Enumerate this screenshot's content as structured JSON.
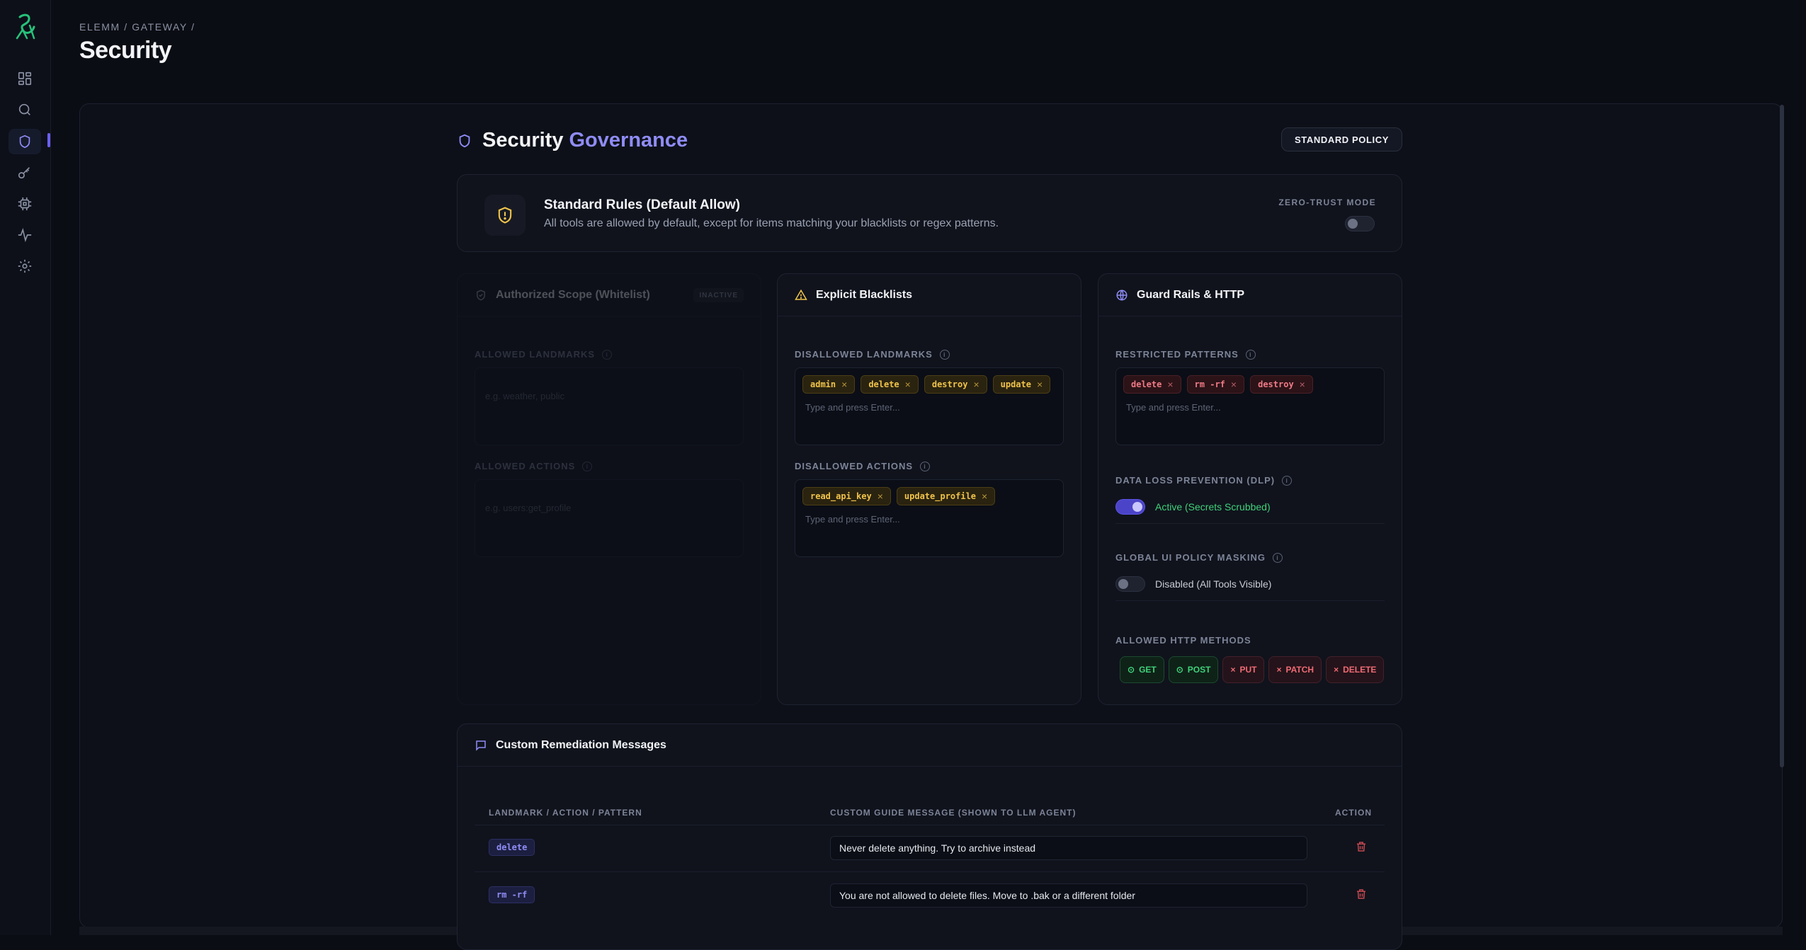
{
  "breadcrumb": "ELEMM / GATEWAY /",
  "page_title": "Security",
  "sidebar": {
    "items": [
      {
        "name": "dashboard",
        "icon": "grid-icon"
      },
      {
        "name": "search",
        "icon": "search-icon"
      },
      {
        "name": "security",
        "icon": "shield-icon",
        "active": true
      },
      {
        "name": "keys",
        "icon": "key-icon"
      },
      {
        "name": "integrations",
        "icon": "chip-icon"
      },
      {
        "name": "activity",
        "icon": "pulse-icon"
      },
      {
        "name": "settings",
        "icon": "gear-icon"
      }
    ]
  },
  "governance": {
    "title_main": "Security ",
    "title_accent": "Governance",
    "policy_pill": "STANDARD POLICY"
  },
  "rules": {
    "title": "Standard Rules (Default Allow)",
    "description": "All tools are allowed by default, except for items matching your blacklists or regex patterns.",
    "zero_trust_label": "ZERO-TRUST MODE",
    "zero_trust_on": false
  },
  "whitelist": {
    "title": "Authorized Scope (Whitelist)",
    "status": "INACTIVE",
    "landmarks_label": "ALLOWED LANDMARKS",
    "landmarks_placeholder": "e.g. weather, public",
    "actions_label": "ALLOWED ACTIONS",
    "actions_placeholder": "e.g. users:get_profile"
  },
  "blacklists": {
    "title": "Explicit Blacklists",
    "landmarks_label": "DISALLOWED LANDMARKS",
    "landmarks": [
      "admin",
      "delete",
      "destroy",
      "update"
    ],
    "actions_label": "DISALLOWED ACTIONS",
    "actions": [
      "read_api_key",
      "update_profile"
    ],
    "input_placeholder": "Type and press Enter..."
  },
  "guardrails": {
    "title": "Guard Rails & HTTP",
    "patterns_label": "RESTRICTED PATTERNS",
    "patterns": [
      "delete",
      "rm -rf",
      "destroy"
    ],
    "input_placeholder": "Type and press Enter...",
    "dlp_label": "DATA LOSS PREVENTION (DLP)",
    "dlp_state": "Active (Secrets Scrubbed)",
    "dlp_on": true,
    "masking_label": "GLOBAL UI POLICY MASKING",
    "masking_state": "Disabled (All Tools Visible)",
    "masking_on": false,
    "methods_label": "ALLOWED HTTP METHODS",
    "methods": [
      {
        "name": "GET",
        "allowed": true
      },
      {
        "name": "POST",
        "allowed": true
      },
      {
        "name": "PUT",
        "allowed": false
      },
      {
        "name": "PATCH",
        "allowed": false
      },
      {
        "name": "DELETE",
        "allowed": false
      }
    ]
  },
  "remediation": {
    "title": "Custom Remediation Messages",
    "col_pattern": "LANDMARK / ACTION / PATTERN",
    "col_message": "CUSTOM GUIDE MESSAGE (SHOWN TO LLM AGENT)",
    "col_action": "ACTION",
    "rows": [
      {
        "pattern": "delete",
        "message": "Never delete anything. Try to archive instead"
      },
      {
        "pattern": "rm -rf",
        "message": "You are not allowed to delete files. Move to .bak or a different folder"
      }
    ]
  },
  "colors": {
    "accent": "#8f8cf6",
    "warning": "#f0c34a",
    "danger": "#f07a85",
    "success": "#3fd27a",
    "background": "#0b0d14"
  }
}
